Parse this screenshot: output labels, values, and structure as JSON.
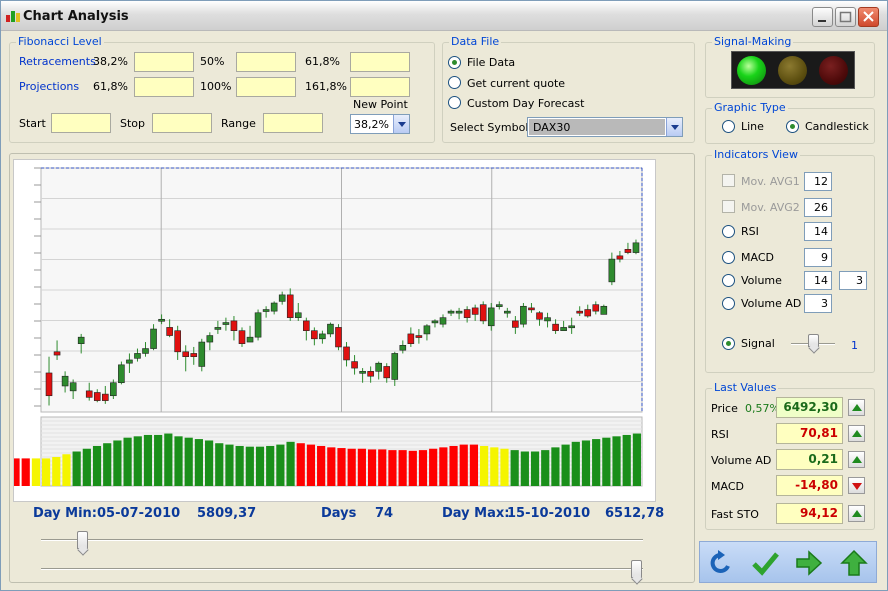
{
  "window": {
    "title": "Chart Analysis"
  },
  "fibonacci": {
    "group_title": "Fibonacci Level",
    "retracements_label": "Retracements",
    "retracements": [
      "38,2%",
      "50%",
      "61,8%"
    ],
    "projections_label": "Projections",
    "projections": [
      "61,8%",
      "100%",
      "161,8%"
    ],
    "new_point_label": "New Point",
    "new_point_value": "38,2%",
    "start_label": "Start",
    "stop_label": "Stop",
    "range_label": "Range"
  },
  "data_file": {
    "group_title": "Data File",
    "options": [
      "File Data",
      "Get current quote",
      "Custom Day Forecast"
    ],
    "selected": 0,
    "symbol_label": "Select Symbol",
    "symbol_value": "DAX30"
  },
  "signal_making": {
    "group_title": "Signal-Making",
    "active_light": "green"
  },
  "graphic_type": {
    "group_title": "Graphic Type",
    "options": [
      "Line",
      "Candlestick"
    ],
    "selected": 1
  },
  "indicators": {
    "group_title": "Indicators View",
    "items": [
      {
        "label": "Mov. AVG1",
        "value": "12",
        "kind": "checkbox",
        "disabled": true
      },
      {
        "label": "Mov. AVG2",
        "value": "26",
        "kind": "checkbox",
        "disabled": true
      },
      {
        "label": "RSI",
        "value": "14",
        "kind": "radio"
      },
      {
        "label": "MACD",
        "value": "9",
        "kind": "radio"
      },
      {
        "label": "Volume",
        "value": "14",
        "value2": "3",
        "kind": "radio"
      },
      {
        "label": "Volume AD",
        "value": "3",
        "kind": "radio"
      }
    ],
    "signal_label": "Signal",
    "signal_value": "1"
  },
  "last_values": {
    "group_title": "Last Values",
    "price_label": "Price",
    "price_change": "0,57%",
    "rows": [
      {
        "label": "Price",
        "value": "6492,30",
        "direction": "up"
      },
      {
        "label": "RSI",
        "value": "70,81",
        "direction": "up"
      },
      {
        "label": "Volume AD",
        "value": "0,21",
        "direction": "up"
      },
      {
        "label": "MACD",
        "value": "-14,80",
        "direction": "down"
      },
      {
        "label": "Fast STO",
        "value": "94,12",
        "direction": "up"
      }
    ]
  },
  "status": {
    "day_min_label": "Day Min:",
    "day_min_date": "05-07-2010",
    "day_min_value": "5809,37",
    "days_label": "Days",
    "days_value": "74",
    "day_max_label": "Day Max:",
    "day_max_date": "15-10-2010",
    "day_max_value": "6512,78"
  },
  "colors": {
    "up": "#2e8b2e",
    "down": "#e01010",
    "signal_red": "#ff0000",
    "signal_yellow": "#f5f500",
    "signal_green": "#1a8f1a"
  },
  "chart_data": {
    "type": "candlestick",
    "series_count": 74,
    "ylim": [
      5780,
      6530
    ],
    "candles": [
      [
        5900,
        5830,
        5950,
        5800
      ],
      [
        5965,
        5955,
        6000,
        5940
      ],
      [
        5860,
        5890,
        5905,
        5840
      ],
      [
        5845,
        5870,
        5880,
        5820
      ],
      [
        5990,
        6010,
        6020,
        5960
      ],
      [
        5845,
        5825,
        5870,
        5815
      ],
      [
        5840,
        5815,
        5850,
        5810
      ],
      [
        5835,
        5815,
        5860,
        5805
      ],
      [
        5830,
        5870,
        5880,
        5820
      ],
      [
        5870,
        5925,
        5935,
        5865
      ],
      [
        5930,
        5940,
        5960,
        5900
      ],
      [
        5945,
        5960,
        5975,
        5935
      ],
      [
        5960,
        5975,
        5995,
        5950
      ],
      [
        5975,
        6035,
        6050,
        5970
      ],
      [
        6060,
        6065,
        6080,
        6050
      ],
      [
        6040,
        6015,
        6065,
        6010
      ],
      [
        6030,
        5965,
        6045,
        5940
      ],
      [
        5965,
        5950,
        5985,
        5905
      ],
      [
        5960,
        5950,
        5980,
        5925
      ],
      [
        5920,
        5995,
        6005,
        5905
      ],
      [
        5995,
        6015,
        6025,
        5970
      ],
      [
        6040,
        6040,
        6060,
        6020
      ],
      [
        6050,
        6055,
        6070,
        6030
      ],
      [
        6060,
        6030,
        6075,
        6000
      ],
      [
        6030,
        5990,
        6040,
        5980
      ],
      [
        5995,
        6010,
        6045,
        5995
      ],
      [
        6010,
        6085,
        6095,
        6000
      ],
      [
        6090,
        6095,
        6105,
        6070
      ],
      [
        6090,
        6115,
        6120,
        6080
      ],
      [
        6120,
        6140,
        6150,
        6110
      ],
      [
        6140,
        6070,
        6160,
        6060
      ],
      [
        6070,
        6085,
        6115,
        6060
      ],
      [
        6060,
        6030,
        6070,
        6000
      ],
      [
        6030,
        6005,
        6040,
        5985
      ],
      [
        6005,
        6020,
        6030,
        5990
      ],
      [
        6020,
        6050,
        6055,
        6010
      ],
      [
        6040,
        5980,
        6050,
        5970
      ],
      [
        5980,
        5940,
        5995,
        5920
      ],
      [
        5935,
        5915,
        5955,
        5895
      ],
      [
        5905,
        5905,
        5915,
        5870
      ],
      [
        5905,
        5890,
        5920,
        5870
      ],
      [
        5905,
        5930,
        5935,
        5880
      ],
      [
        5920,
        5885,
        5930,
        5870
      ],
      [
        5880,
        5960,
        5965,
        5860
      ],
      [
        5970,
        5985,
        6000,
        5960
      ],
      [
        6020,
        5990,
        6040,
        5980
      ],
      [
        6015,
        6010,
        6035,
        5990
      ],
      [
        6020,
        6045,
        6050,
        6000
      ],
      [
        6060,
        6060,
        6065,
        6040
      ],
      [
        6050,
        6070,
        6080,
        6040
      ],
      [
        6090,
        6090,
        6095,
        6075
      ],
      [
        6085,
        6090,
        6100,
        6065
      ],
      [
        6095,
        6070,
        6105,
        6055
      ],
      [
        6100,
        6080,
        6110,
        6060
      ],
      [
        6110,
        6060,
        6120,
        6050
      ],
      [
        6045,
        6100,
        6115,
        6030
      ],
      [
        6105,
        6110,
        6120,
        6095
      ],
      [
        6085,
        6090,
        6100,
        6070
      ],
      [
        6060,
        6040,
        6075,
        6020
      ],
      [
        6050,
        6105,
        6115,
        6040
      ],
      [
        6100,
        6095,
        6115,
        6085
      ],
      [
        6085,
        6065,
        6090,
        6045
      ],
      [
        6060,
        6070,
        6085,
        6040
      ],
      [
        6050,
        6030,
        6065,
        6020
      ],
      [
        6030,
        6040,
        6060,
        6030
      ],
      [
        6040,
        6045,
        6070,
        6020
      ],
      [
        6090,
        6085,
        6105,
        6075
      ],
      [
        6095,
        6075,
        6110,
        6070
      ],
      [
        6110,
        6090,
        6120,
        6080
      ],
      [
        6080,
        6105,
        6110,
        6080
      ],
      [
        6180,
        6250,
        6270,
        6170
      ],
      [
        6260,
        6250,
        6275,
        6240
      ],
      [
        6280,
        6270,
        6300,
        6265
      ],
      [
        6270,
        6300,
        6310,
        6265
      ]
    ],
    "signal_strip": {
      "kinds": [
        "red",
        "red",
        "red",
        "red",
        "yellow",
        "yellow",
        "yellow",
        "yellow",
        "green",
        "green",
        "green",
        "green",
        "green",
        "green",
        "green",
        "green",
        "green",
        "green",
        "green",
        "green",
        "green",
        "green",
        "green",
        "green",
        "green",
        "green",
        "green",
        "green",
        "green",
        "green",
        "red",
        "red",
        "red",
        "red",
        "red",
        "red",
        "red",
        "red",
        "red",
        "red",
        "red",
        "red",
        "red",
        "red",
        "red",
        "red",
        "red",
        "red",
        "yellow",
        "yellow",
        "yellow",
        "green",
        "green",
        "green",
        "green",
        "green",
        "green",
        "green",
        "green",
        "green",
        "green",
        "green",
        "green",
        "green"
      ],
      "levels": [
        0.35,
        0.38,
        0.4,
        0.4,
        0.4,
        0.4,
        0.42,
        0.46,
        0.5,
        0.54,
        0.58,
        0.62,
        0.66,
        0.7,
        0.72,
        0.74,
        0.74,
        0.76,
        0.72,
        0.7,
        0.68,
        0.66,
        0.62,
        0.6,
        0.58,
        0.57,
        0.57,
        0.58,
        0.6,
        0.64,
        0.62,
        0.6,
        0.58,
        0.56,
        0.55,
        0.54,
        0.54,
        0.53,
        0.53,
        0.52,
        0.52,
        0.51,
        0.52,
        0.54,
        0.56,
        0.58,
        0.6,
        0.6,
        0.58,
        0.56,
        0.54,
        0.52,
        0.5,
        0.5,
        0.52,
        0.56,
        0.6,
        0.64,
        0.66,
        0.68,
        0.7,
        0.72,
        0.74,
        0.76
      ]
    }
  }
}
